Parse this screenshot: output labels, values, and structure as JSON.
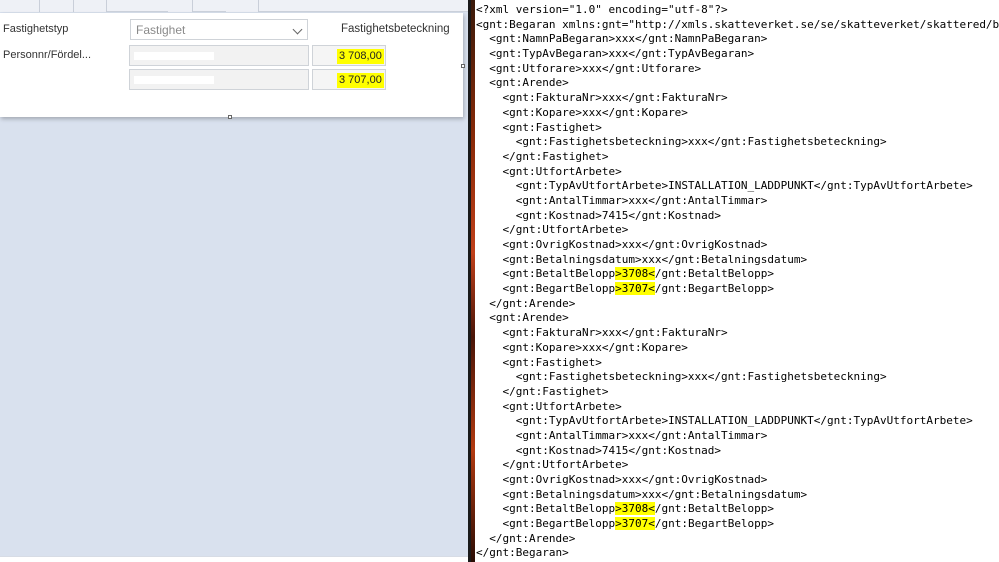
{
  "form": {
    "property_type_label": "Fastighetstyp",
    "property_type_value": "Fastighet",
    "property_designation_label": "Fastighetsbeteckning",
    "personnr_label": "Personnr/Fördel...",
    "amount_row1": "3 708,00",
    "amount_row2": "3 707,00"
  },
  "xml": {
    "lines": [
      {
        "indent": 0,
        "pre": "<?xml version=\"1.0\" encoding=\"utf-8\"?>"
      },
      {
        "indent": 0,
        "pre": "<gnt:Begaran xmlns:gnt=\"http://xmls.skatteverket.se/se/skatteverket/skattered/b"
      },
      {
        "indent": 1,
        "pre": "<gnt:NamnPaBegaran>xxx</gnt:NamnPaBegaran>"
      },
      {
        "indent": 1,
        "pre": "<gnt:TypAvBegaran>xxx</gnt:TypAvBegaran>"
      },
      {
        "indent": 1,
        "pre": "<gnt:Utforare>xxx</gnt:Utforare>"
      },
      {
        "indent": 1,
        "pre": "<gnt:Arende>"
      },
      {
        "indent": 2,
        "pre": "<gnt:FakturaNr>xxx</gnt:FakturaNr>"
      },
      {
        "indent": 2,
        "pre": "<gnt:Kopare>xxx</gnt:Kopare>"
      },
      {
        "indent": 2,
        "pre": "<gnt:Fastighet>"
      },
      {
        "indent": 3,
        "pre": "<gnt:Fastighetsbeteckning>xxx</gnt:Fastighetsbeteckning>"
      },
      {
        "indent": 2,
        "pre": "</gnt:Fastighet>"
      },
      {
        "indent": 2,
        "pre": "<gnt:UtfortArbete>"
      },
      {
        "indent": 3,
        "pre": "<gnt:TypAvUtfortArbete>INSTALLATION_LADDPUNKT</gnt:TypAvUtfortArbete>"
      },
      {
        "indent": 3,
        "pre": "<gnt:AntalTimmar>xxx</gnt:AntalTimmar>"
      },
      {
        "indent": 3,
        "pre": "<gnt:Kostnad>7415</gnt:Kostnad>"
      },
      {
        "indent": 2,
        "pre": "</gnt:UtfortArbete>"
      },
      {
        "indent": 2,
        "pre": "<gnt:OvrigKostnad>xxx</gnt:OvrigKostnad>"
      },
      {
        "indent": 2,
        "pre": "<gnt:Betalningsdatum>xxx</gnt:Betalningsdatum>"
      },
      {
        "indent": 2,
        "pre": "<gnt:BetaltBelopp",
        "hl": ">3708<",
        "post": "/gnt:BetaltBelopp>"
      },
      {
        "indent": 2,
        "pre": "<gnt:BegartBelopp",
        "hl": ">3707<",
        "post": "/gnt:BegartBelopp>"
      },
      {
        "indent": 1,
        "pre": "</gnt:Arende>"
      },
      {
        "indent": 1,
        "pre": "<gnt:Arende>"
      },
      {
        "indent": 2,
        "pre": "<gnt:FakturaNr>xxx</gnt:FakturaNr>"
      },
      {
        "indent": 2,
        "pre": "<gnt:Kopare>xxx</gnt:Kopare>"
      },
      {
        "indent": 2,
        "pre": "<gnt:Fastighet>"
      },
      {
        "indent": 3,
        "pre": "<gnt:Fastighetsbeteckning>xxx</gnt:Fastighetsbeteckning>"
      },
      {
        "indent": 2,
        "pre": "</gnt:Fastighet>"
      },
      {
        "indent": 2,
        "pre": "<gnt:UtfortArbete>"
      },
      {
        "indent": 3,
        "pre": "<gnt:TypAvUtfortArbete>INSTALLATION_LADDPUNKT</gnt:TypAvUtfortArbete>"
      },
      {
        "indent": 3,
        "pre": "<gnt:AntalTimmar>xxx</gnt:AntalTimmar>"
      },
      {
        "indent": 3,
        "pre": "<gnt:Kostnad>7415</gnt:Kostnad>"
      },
      {
        "indent": 2,
        "pre": "</gnt:UtfortArbete>"
      },
      {
        "indent": 2,
        "pre": "<gnt:OvrigKostnad>xxx</gnt:OvrigKostnad>"
      },
      {
        "indent": 2,
        "pre": "<gnt:Betalningsdatum>xxx</gnt:Betalningsdatum>"
      },
      {
        "indent": 2,
        "pre": "<gnt:BetaltBelopp",
        "hl": ">3708<",
        "post": "/gnt:BetaltBelopp>"
      },
      {
        "indent": 2,
        "pre": "<gnt:BegartBelopp",
        "hl": ">3707<",
        "post": "/gnt:BegartBelopp>"
      },
      {
        "indent": 1,
        "pre": "</gnt:Arende>"
      },
      {
        "indent": 0,
        "pre": "</gnt:Begaran>"
      }
    ]
  },
  "colors": {
    "highlight": "#ffff00",
    "pane_background": "#d9e1ee"
  }
}
